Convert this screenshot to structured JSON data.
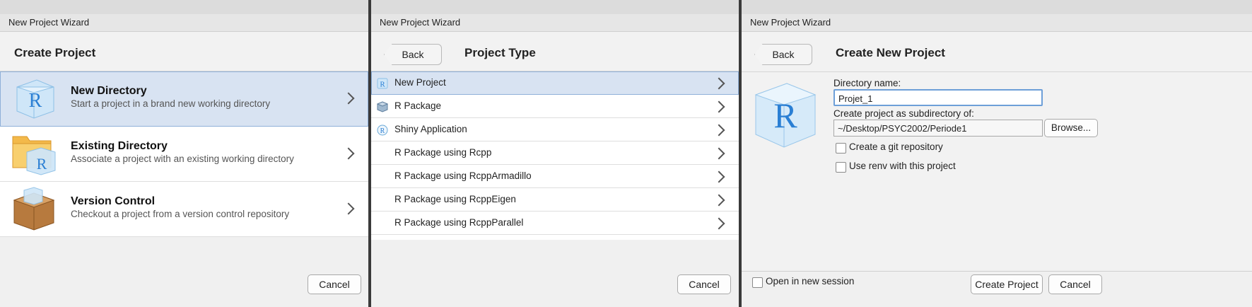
{
  "panel1": {
    "window_title": "New Project Wizard",
    "heading": "Create Project",
    "options": [
      {
        "title": "New Directory",
        "subtitle": "Start a project in a brand new working directory",
        "icon": "r-cube-icon"
      },
      {
        "title": "Existing Directory",
        "subtitle": "Associate a project with an existing working directory",
        "icon": "folder-r-icon"
      },
      {
        "title": "Version Control",
        "subtitle": "Checkout a project from a version control repository",
        "icon": "box-icon"
      }
    ],
    "cancel_label": "Cancel"
  },
  "panel2": {
    "window_title": "New Project Wizard",
    "back_label": "Back",
    "heading": "Project Type",
    "items": [
      {
        "label": "New Project",
        "icon": "r-icon"
      },
      {
        "label": "R Package",
        "icon": "package-icon"
      },
      {
        "label": "Shiny Application",
        "icon": "shiny-icon"
      },
      {
        "label": "R Package using Rcpp"
      },
      {
        "label": "R Package using RcppArmadillo"
      },
      {
        "label": "R Package using RcppEigen"
      },
      {
        "label": "R Package using RcppParallel"
      }
    ],
    "cancel_label": "Cancel"
  },
  "panel3": {
    "window_title": "New Project Wizard",
    "back_label": "Back",
    "heading": "Create New Project",
    "dir_name_label": "Directory name:",
    "dir_name_value": "Projet_1",
    "subdir_label": "Create project as subdirectory of:",
    "subdir_value": "~/Desktop/PSYC2002/Periode1",
    "browse_label": "Browse...",
    "git_label": "Create a git repository",
    "renv_label": "Use renv with this project",
    "new_session_label": "Open in new session",
    "create_label": "Create Project",
    "cancel_label": "Cancel"
  },
  "colors": {
    "selected_row": "#d8e3f2",
    "r_blue": "#2a7fd4"
  }
}
